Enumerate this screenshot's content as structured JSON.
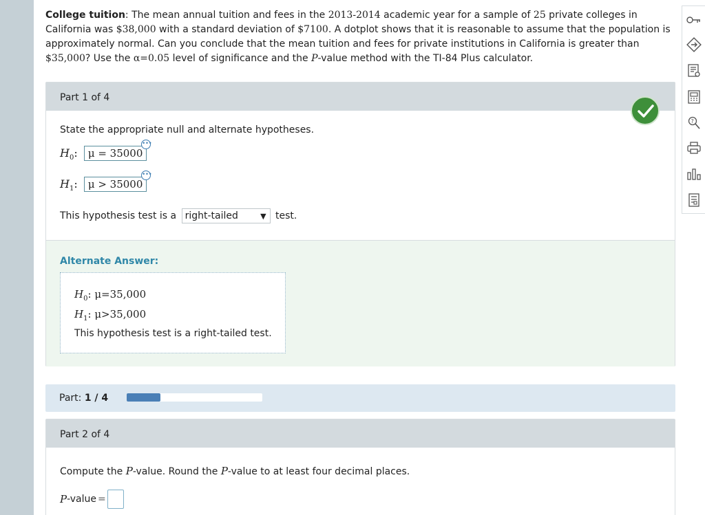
{
  "problem": {
    "title": "College tuition",
    "sentence1_a": ": The mean annual tuition and fees in the ",
    "years": "2013-2014",
    "sentence1_b": " academic year for a sample of ",
    "n": "25",
    "sentence1_c": " private colleges in California was ",
    "mean": "$38,000",
    "sentence1_d": " with a standard deviation of ",
    "sd": "$7100",
    "sentence1_e": ". A dotplot shows that it is reasonable to assume that the population is approximately normal. Can you conclude that the mean tuition and fees for private institutions in California is greater than ",
    "mu0": "$35,000",
    "sentence1_f": "? Use the ",
    "alpha": "α=0.05",
    "sentence1_g": " level of significance and the ",
    "pvar": "P",
    "sentence1_h": "-value method with the TI-84 Plus calculator."
  },
  "part1": {
    "header": "Part 1 of 4",
    "instruction": "State the appropriate null and alternate hypotheses.",
    "h0_label": "H",
    "h0_sub": "0",
    "h0_value": "μ = 35000",
    "h1_label": "H",
    "h1_sub": "1",
    "h1_value": "μ > 35000",
    "test_prefix": "This hypothesis test is a",
    "test_selected": "right-tailed",
    "test_suffix": "test.",
    "alt_title": "Alternate Answer:",
    "alt_h0": "μ=35,000",
    "alt_h1": "μ>35,000",
    "alt_text": "This hypothesis test is a right-tailed test."
  },
  "progress": {
    "label": "Part:",
    "value_text": "1 / 4",
    "fraction": 0.25
  },
  "part2": {
    "header": "Part 2 of 4",
    "instruction_a": "Compute the ",
    "instruction_b": "-value. Round the ",
    "instruction_c": "-value to at least four decimal places.",
    "pvalue_var": "P",
    "pvalue_label": "-value",
    "equals": "="
  },
  "colors": {
    "check": "#3e8f3a",
    "accent": "#2f87a8",
    "progress": "#4a7fb6"
  }
}
